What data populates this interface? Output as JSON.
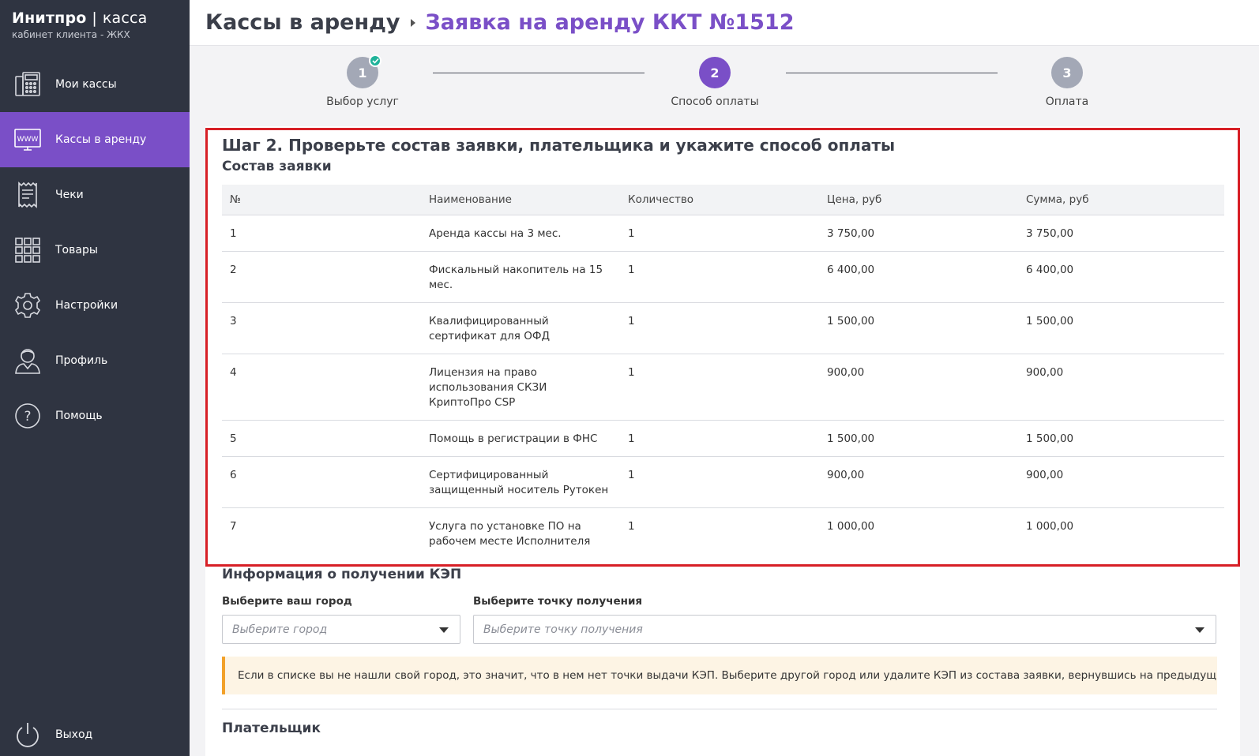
{
  "brand": {
    "name": "Инитпро",
    "separator": "|",
    "product": "касса",
    "subtitle": "кабинет клиента - ЖКХ"
  },
  "sidebar": {
    "items": [
      {
        "label": "Мои кассы",
        "icon": "cash-register-icon"
      },
      {
        "label": "Кассы в аренду",
        "icon": "www-monitor-icon",
        "active": true
      },
      {
        "label": "Чеки",
        "icon": "receipt-icon"
      },
      {
        "label": "Товары",
        "icon": "grid-icon"
      },
      {
        "label": "Настройки",
        "icon": "gear-icon"
      },
      {
        "label": "Профиль",
        "icon": "user-icon"
      },
      {
        "label": "Помощь",
        "icon": "help-icon"
      }
    ],
    "exit": {
      "label": "Выход",
      "icon": "power-icon"
    }
  },
  "header": {
    "root": "Кассы в аренду",
    "current": "Заявка на аренду ККТ №1512"
  },
  "stepper": {
    "steps": [
      {
        "number": "1",
        "label": "Выбор услуг",
        "state": "done"
      },
      {
        "number": "2",
        "label": "Способ оплаты",
        "state": "active"
      },
      {
        "number": "3",
        "label": "Оплата",
        "state": "pending"
      }
    ]
  },
  "main": {
    "step_title": "Шаг 2. Проверьте состав заявки, плательщика и укажите способ оплаты",
    "order_title": "Состав заявки",
    "table": {
      "headers": [
        "№",
        "Наименование",
        "Количество",
        "Цена, руб",
        "Сумма, руб"
      ],
      "rows": [
        [
          "1",
          "Аренда кассы на 3 мес.",
          "1",
          "3 750,00",
          "3 750,00"
        ],
        [
          "2",
          "Фискальный накопитель на 15 мес.",
          "1",
          "6 400,00",
          "6 400,00"
        ],
        [
          "3",
          "Квалифицированный сертификат для ОФД",
          "1",
          "1 500,00",
          "1 500,00"
        ],
        [
          "4",
          "Лицензия на право использования СКЗИ КриптоПро CSP",
          "1",
          "900,00",
          "900,00"
        ],
        [
          "5",
          "Помощь в регистрации в ФНС",
          "1",
          "1 500,00",
          "1 500,00"
        ],
        [
          "6",
          "Сертифицированный защищенный носитель Рутокен",
          "1",
          "900,00",
          "900,00"
        ],
        [
          "7",
          "Услуга по установке ПО на рабочем месте Исполнителя",
          "1",
          "1 000,00",
          "1 000,00"
        ]
      ]
    },
    "kep_title": "Информация о получении КЭП",
    "city": {
      "label": "Выберите ваш город",
      "placeholder": "Выберите город"
    },
    "point": {
      "label": "Выберите точку получения",
      "placeholder": "Выберите точку получения"
    },
    "notice": "Если в списке вы не нашли свой город, это значит, что в нем нет точки выдачи КЭП. Выберите другой город или удалите КЭП из состава заявки, вернувшись на предыдущий шаг.",
    "payer_title": "Плательщик"
  },
  "colors": {
    "accent": "#7a4fc7",
    "sidebar": "#2f3441",
    "highlight": "#d71f26",
    "notice_border": "#f2a12a",
    "check": "#1fb39a"
  }
}
